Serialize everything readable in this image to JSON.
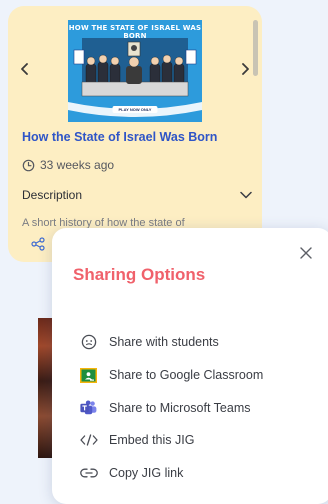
{
  "card": {
    "thumbnail_title": "HOW THE STATE OF ISRAEL WAS BORN",
    "thumbnail_caption": "PLAY NOW ONLY",
    "title": "How the State of Israel Was Born",
    "age": "33 weeks ago",
    "description_label": "Description",
    "description_preview": "A short history of how the state of",
    "colors": {
      "background": "#fdeec3",
      "title": "#2f55c7"
    }
  },
  "share": {
    "title": "Sharing Options",
    "options": [
      {
        "label": "Share with students",
        "icon": "students-face-icon"
      },
      {
        "label": "Share to Google Classroom",
        "icon": "google-classroom-icon"
      },
      {
        "label": "Share to Microsoft Teams",
        "icon": "microsoft-teams-icon"
      },
      {
        "label": "Embed this JIG",
        "icon": "embed-code-icon"
      },
      {
        "label": "Copy JIG link",
        "icon": "link-icon"
      }
    ],
    "colors": {
      "title": "#f0616b"
    }
  }
}
